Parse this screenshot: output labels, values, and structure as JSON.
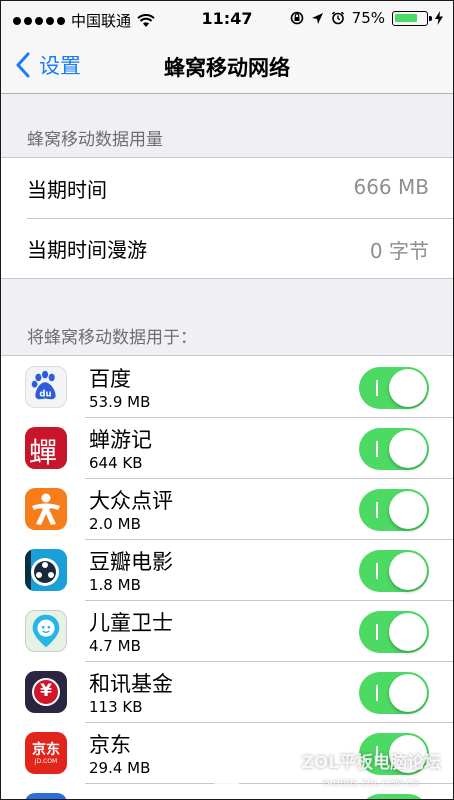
{
  "status_bar": {
    "carrier": "中国联通",
    "time": "11:47",
    "battery_percent": "75%",
    "battery_level": 0.75
  },
  "nav": {
    "back_label": "设置",
    "title": "蜂窝移动网络"
  },
  "usage_section": {
    "header": "蜂窝移动数据用量",
    "rows": [
      {
        "label": "当期时间",
        "value": "666 MB"
      },
      {
        "label": "当期时间漫游",
        "value": "0 字节"
      }
    ]
  },
  "apps_section": {
    "header": "将蜂窝移动数据用于：",
    "apps": [
      {
        "name": "百度",
        "size": "53.9 MB",
        "enabled": true,
        "icon": "baidu-icon"
      },
      {
        "name": "蝉游记",
        "size": "644 KB",
        "enabled": true,
        "icon": "chanyouji-icon",
        "icon_text": "蟬"
      },
      {
        "name": "大众点评",
        "size": "2.0 MB",
        "enabled": true,
        "icon": "dianping-icon"
      },
      {
        "name": "豆瓣电影",
        "size": "1.8 MB",
        "enabled": true,
        "icon": "douban-movie-icon"
      },
      {
        "name": "儿童卫士",
        "size": "4.7 MB",
        "enabled": true,
        "icon": "child-guard-icon"
      },
      {
        "name": "和讯基金",
        "size": "113 KB",
        "enabled": true,
        "icon": "hexun-fund-icon",
        "icon_text": "¥"
      },
      {
        "name": "京东",
        "size": "29.4 MB",
        "enabled": true,
        "icon": "jd-icon",
        "icon_text": "京东",
        "icon_subtext": "JD.COM"
      }
    ]
  },
  "watermark": {
    "text": "ZOL平板电脑论坛",
    "subtext": "PADBBS.ZOL.COM.CN"
  },
  "colors": {
    "accent": "#1a7cf7",
    "toggle_on": "#4cd964",
    "background": "#efeff4"
  }
}
